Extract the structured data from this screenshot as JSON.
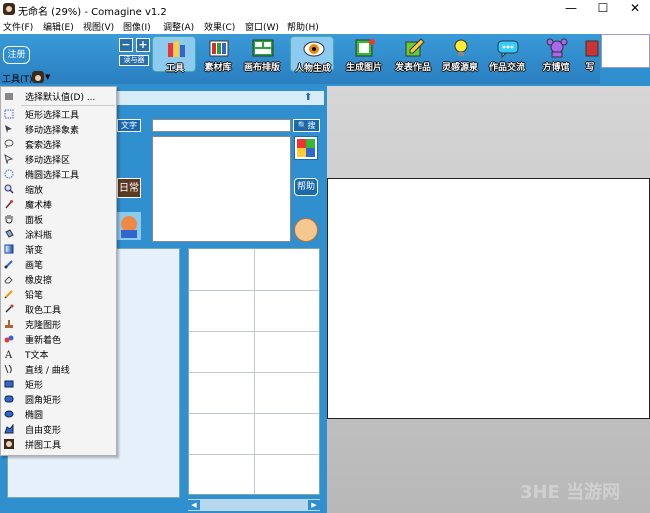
{
  "window": {
    "title": "无命名 (29%) - Comagine v1.2",
    "controls": [
      "—",
      "☐",
      "✕"
    ]
  },
  "menu": [
    {
      "label": "文件(F)"
    },
    {
      "label": "编辑(E)"
    },
    {
      "label": "视图(V)"
    },
    {
      "label": "图像(I)"
    },
    {
      "label": "调整(A)"
    },
    {
      "label": "效果(C)"
    },
    {
      "label": "窗口(W)"
    },
    {
      "label": "帮助(H)"
    }
  ],
  "toolbar": {
    "register_label": "注册",
    "zoom_out": "−",
    "zoom_in": "+",
    "zoom_label": "读与器",
    "buttons": [
      {
        "label": "工具",
        "icon": "tools-icon",
        "selected": true
      },
      {
        "label": "素材库",
        "icon": "materials-icon"
      },
      {
        "label": "画布排版",
        "icon": "layout-icon"
      },
      {
        "label": "人物生成",
        "icon": "eye-icon"
      },
      {
        "label": "生成图片",
        "icon": "image-icon"
      },
      {
        "label": "发表作品",
        "icon": "publish-icon"
      },
      {
        "label": "灵感源泉",
        "icon": "lightbulb-icon"
      },
      {
        "label": "作品交流",
        "icon": "chat-icon"
      },
      {
        "label": "方博馆",
        "icon": "museum-icon"
      },
      {
        "label": "写",
        "icon": "write-icon"
      }
    ]
  },
  "tools_menu": {
    "label": "工具(T)",
    "items": [
      {
        "label": "选择默认值(D) ...",
        "icon": "default-icon"
      },
      {
        "label": "矩形选择工具",
        "icon": "rect-select-icon"
      },
      {
        "label": "移动选择象素",
        "icon": "move-pixels-icon"
      },
      {
        "label": "套索选择",
        "icon": "lasso-icon"
      },
      {
        "label": "移动选择区",
        "icon": "move-selection-icon"
      },
      {
        "label": "椭圆选择工具",
        "icon": "ellipse-select-icon"
      },
      {
        "label": "缩放",
        "icon": "zoom-icon"
      },
      {
        "label": "魔术棒",
        "icon": "magic-wand-icon"
      },
      {
        "label": "面板",
        "icon": "hand-icon"
      },
      {
        "label": "涂料瓶",
        "icon": "paint-bucket-icon"
      },
      {
        "label": "渐变",
        "icon": "gradient-icon"
      },
      {
        "label": "画笔",
        "icon": "brush-icon"
      },
      {
        "label": "橡皮擦",
        "icon": "eraser-icon"
      },
      {
        "label": "铅笔",
        "icon": "pencil-icon"
      },
      {
        "label": "取色工具",
        "icon": "color-picker-icon"
      },
      {
        "label": "克隆图形",
        "icon": "clone-stamp-icon"
      },
      {
        "label": "重新着色",
        "icon": "recolor-icon"
      },
      {
        "label": "T文本",
        "icon": "text-icon"
      },
      {
        "label": "直线 / 曲线",
        "icon": "line-curve-icon"
      },
      {
        "label": "矩形",
        "icon": "rectangle-icon"
      },
      {
        "label": "圆角矩形",
        "icon": "rounded-rect-icon"
      },
      {
        "label": "椭圆",
        "icon": "ellipse-icon"
      },
      {
        "label": "自由变形",
        "icon": "free-transform-icon"
      },
      {
        "label": "拼图工具",
        "icon": "puzzle-icon"
      }
    ]
  },
  "panel": {
    "up_arrow": "⬆",
    "text_button": "文字",
    "search_button": "🔍搜",
    "help_button": "帮助",
    "daily_tag": "日常",
    "scroll_left": "◀",
    "scroll_right": "▶"
  },
  "watermark": "3HE 当游网",
  "colors": {
    "brand_blue": "#2f8fcf",
    "canvas_gray": "#c8c8c8",
    "menu_bg": "#f4f4f4"
  }
}
